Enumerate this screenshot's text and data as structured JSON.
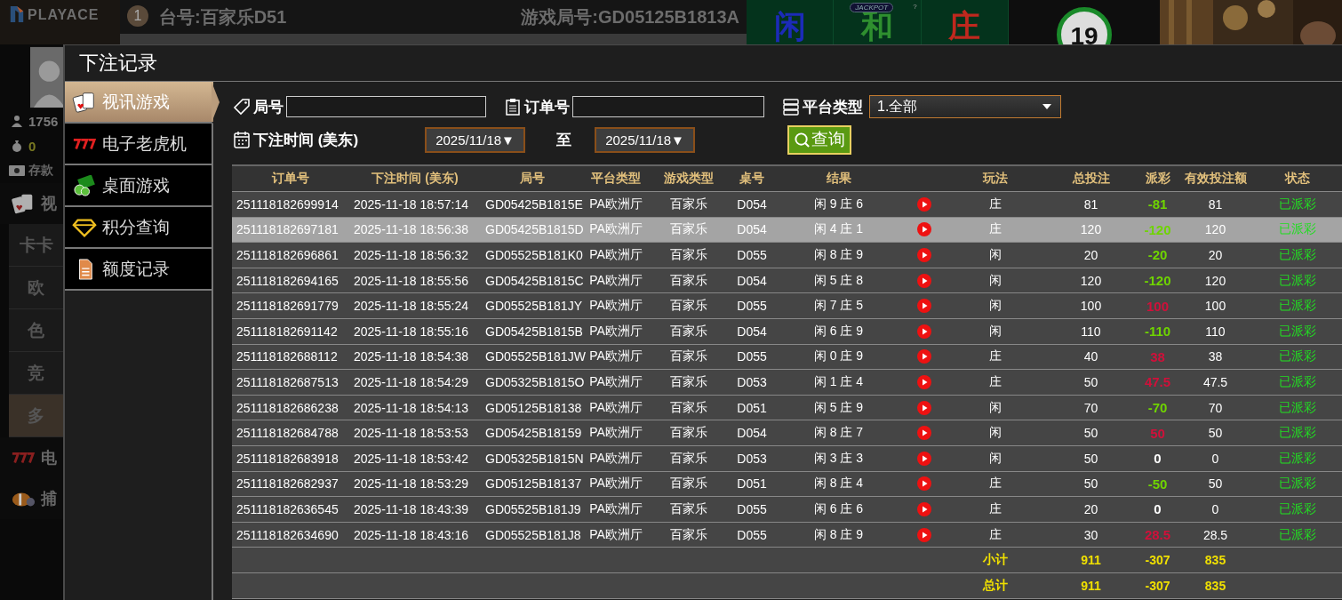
{
  "background": {
    "logo": "PLAYACE",
    "table_badge": "1",
    "table_name": "台号:百家乐D51",
    "round_id": "游戏局号:GD05125B1813A",
    "scoreboard": [
      {
        "label": "闲",
        "color": "#1c2bb8"
      },
      {
        "label": "和",
        "color": "#2f8f2f"
      },
      {
        "label": "庄",
        "color": "#c0281e"
      }
    ],
    "jackpot": "JACKPOT",
    "help": "?",
    "countdown": "19",
    "balance": "1756",
    "points": "0",
    "deposit": "存款",
    "menu": [
      {
        "kind": "category",
        "label": "视"
      },
      {
        "kind": "sub",
        "label": "卡卡",
        "selected": false
      },
      {
        "kind": "sub",
        "label": "欧",
        "selected": false
      },
      {
        "kind": "sub",
        "label": "色",
        "selected": false
      },
      {
        "kind": "sub",
        "label": "竞",
        "selected": false
      },
      {
        "kind": "sub",
        "label": "多",
        "selected": true
      },
      {
        "kind": "category",
        "label": "电"
      },
      {
        "kind": "category",
        "label": "捕"
      }
    ]
  },
  "dialog": {
    "title": "下注记录",
    "sidebar": [
      {
        "label": "视讯游戏",
        "selected": true
      },
      {
        "label": "电子老虎机",
        "selected": false
      },
      {
        "label": "桌面游戏",
        "selected": false
      },
      {
        "label": "积分查询",
        "selected": false
      },
      {
        "label": "额度记录",
        "selected": false
      }
    ],
    "filters": {
      "round_label": "局号",
      "order_label": "订单号",
      "platform_label": "平台类型",
      "platform_value": "1.全部",
      "time_label": "下注时间 (美东)",
      "date_from": "2025/11/18▼",
      "to_label": "至",
      "date_to": "2025/11/18▼",
      "query_button": "查询"
    },
    "table": {
      "columns": [
        "订单号",
        "下注时间 (美东)",
        "局号",
        "平台类型",
        "游戏类型",
        "桌号",
        "结果",
        "玩法",
        "总投注",
        "派彩",
        "有效投注额",
        "状态"
      ],
      "rows": [
        {
          "order": "251118182699914",
          "time": "2025-11-18 18:57:14",
          "round": "GD05425B1815E",
          "platform": "PA欧洲厅",
          "game": "百家乐",
          "table": "D054",
          "result": "闲 9 庄 6",
          "play": "庄",
          "bet": "81",
          "payout": {
            "text": "-81",
            "color": "#6fd400"
          },
          "valid": "81",
          "status": "已派彩",
          "selected": false
        },
        {
          "order": "251118182697181",
          "time": "2025-11-18 18:56:38",
          "round": "GD05425B1815D",
          "platform": "PA欧洲厅",
          "game": "百家乐",
          "table": "D054",
          "result": "闲 4 庄 1",
          "play": "庄",
          "bet": "120",
          "payout": {
            "text": "-120",
            "color": "#6fd400"
          },
          "valid": "120",
          "status": "已派彩",
          "selected": true
        },
        {
          "order": "251118182696861",
          "time": "2025-11-18 18:56:32",
          "round": "GD05525B181K0",
          "platform": "PA欧洲厅",
          "game": "百家乐",
          "table": "D055",
          "result": "闲 8 庄 9",
          "play": "闲",
          "bet": "20",
          "payout": {
            "text": "-20",
            "color": "#6fd400"
          },
          "valid": "20",
          "status": "已派彩",
          "selected": false
        },
        {
          "order": "251118182694165",
          "time": "2025-11-18 18:55:56",
          "round": "GD05425B1815C",
          "platform": "PA欧洲厅",
          "game": "百家乐",
          "table": "D054",
          "result": "闲 5 庄 8",
          "play": "闲",
          "bet": "120",
          "payout": {
            "text": "-120",
            "color": "#6fd400"
          },
          "valid": "120",
          "status": "已派彩",
          "selected": false
        },
        {
          "order": "251118182691779",
          "time": "2025-11-18 18:55:24",
          "round": "GD05525B181JY",
          "platform": "PA欧洲厅",
          "game": "百家乐",
          "table": "D055",
          "result": "闲 7 庄 5",
          "play": "闲",
          "bet": "100",
          "payout": {
            "text": "100",
            "color": "#d0103a"
          },
          "valid": "100",
          "status": "已派彩",
          "selected": false
        },
        {
          "order": "251118182691142",
          "time": "2025-11-18 18:55:16",
          "round": "GD05425B1815B",
          "platform": "PA欧洲厅",
          "game": "百家乐",
          "table": "D054",
          "result": "闲 6 庄 9",
          "play": "闲",
          "bet": "110",
          "payout": {
            "text": "-110",
            "color": "#6fd400"
          },
          "valid": "110",
          "status": "已派彩",
          "selected": false
        },
        {
          "order": "251118182688112",
          "time": "2025-11-18 18:54:38",
          "round": "GD05525B181JW",
          "platform": "PA欧洲厅",
          "game": "百家乐",
          "table": "D055",
          "result": "闲 0 庄 9",
          "play": "庄",
          "bet": "40",
          "payout": {
            "text": "38",
            "color": "#d0103a"
          },
          "valid": "38",
          "status": "已派彩",
          "selected": false
        },
        {
          "order": "251118182687513",
          "time": "2025-11-18 18:54:29",
          "round": "GD05325B1815O",
          "platform": "PA欧洲厅",
          "game": "百家乐",
          "table": "D053",
          "result": "闲 1 庄 4",
          "play": "庄",
          "bet": "50",
          "payout": {
            "text": "47.5",
            "color": "#d0103a"
          },
          "valid": "47.5",
          "status": "已派彩",
          "selected": false
        },
        {
          "order": "251118182686238",
          "time": "2025-11-18 18:54:13",
          "round": "GD05125B18138",
          "platform": "PA欧洲厅",
          "game": "百家乐",
          "table": "D051",
          "result": "闲 5 庄 9",
          "play": "闲",
          "bet": "70",
          "payout": {
            "text": "-70",
            "color": "#6fd400"
          },
          "valid": "70",
          "status": "已派彩",
          "selected": false
        },
        {
          "order": "251118182684788",
          "time": "2025-11-18 18:53:53",
          "round": "GD05425B18159",
          "platform": "PA欧洲厅",
          "game": "百家乐",
          "table": "D054",
          "result": "闲 8 庄 7",
          "play": "闲",
          "bet": "50",
          "payout": {
            "text": "50",
            "color": "#d0103a"
          },
          "valid": "50",
          "status": "已派彩",
          "selected": false
        },
        {
          "order": "251118182683918",
          "time": "2025-11-18 18:53:42",
          "round": "GD05325B1815N",
          "platform": "PA欧洲厅",
          "game": "百家乐",
          "table": "D053",
          "result": "闲 3 庄 3",
          "play": "闲",
          "bet": "50",
          "payout": {
            "text": "0",
            "color": "#ffffff"
          },
          "valid": "0",
          "status": "已派彩",
          "selected": false
        },
        {
          "order": "251118182682937",
          "time": "2025-11-18 18:53:29",
          "round": "GD05125B18137",
          "platform": "PA欧洲厅",
          "game": "百家乐",
          "table": "D051",
          "result": "闲 8 庄 4",
          "play": "庄",
          "bet": "50",
          "payout": {
            "text": "-50",
            "color": "#6fd400"
          },
          "valid": "50",
          "status": "已派彩",
          "selected": false
        },
        {
          "order": "251118182636545",
          "time": "2025-11-18 18:43:39",
          "round": "GD05525B181J9",
          "platform": "PA欧洲厅",
          "game": "百家乐",
          "table": "D055",
          "result": "闲 6 庄 6",
          "play": "庄",
          "bet": "20",
          "payout": {
            "text": "0",
            "color": "#ffffff"
          },
          "valid": "0",
          "status": "已派彩",
          "selected": false
        },
        {
          "order": "251118182634690",
          "time": "2025-11-18 18:43:16",
          "round": "GD05525B181J8",
          "platform": "PA欧洲厅",
          "game": "百家乐",
          "table": "D055",
          "result": "闲 8 庄 9",
          "play": "庄",
          "bet": "30",
          "payout": {
            "text": "28.5",
            "color": "#d0103a"
          },
          "valid": "28.5",
          "status": "已派彩",
          "selected": false
        }
      ],
      "totals": [
        {
          "label": "小计",
          "bet": "911",
          "payout": "-307",
          "valid": "835"
        },
        {
          "label": "总计",
          "bet": "911",
          "payout": "-307",
          "valid": "835"
        }
      ]
    }
  }
}
